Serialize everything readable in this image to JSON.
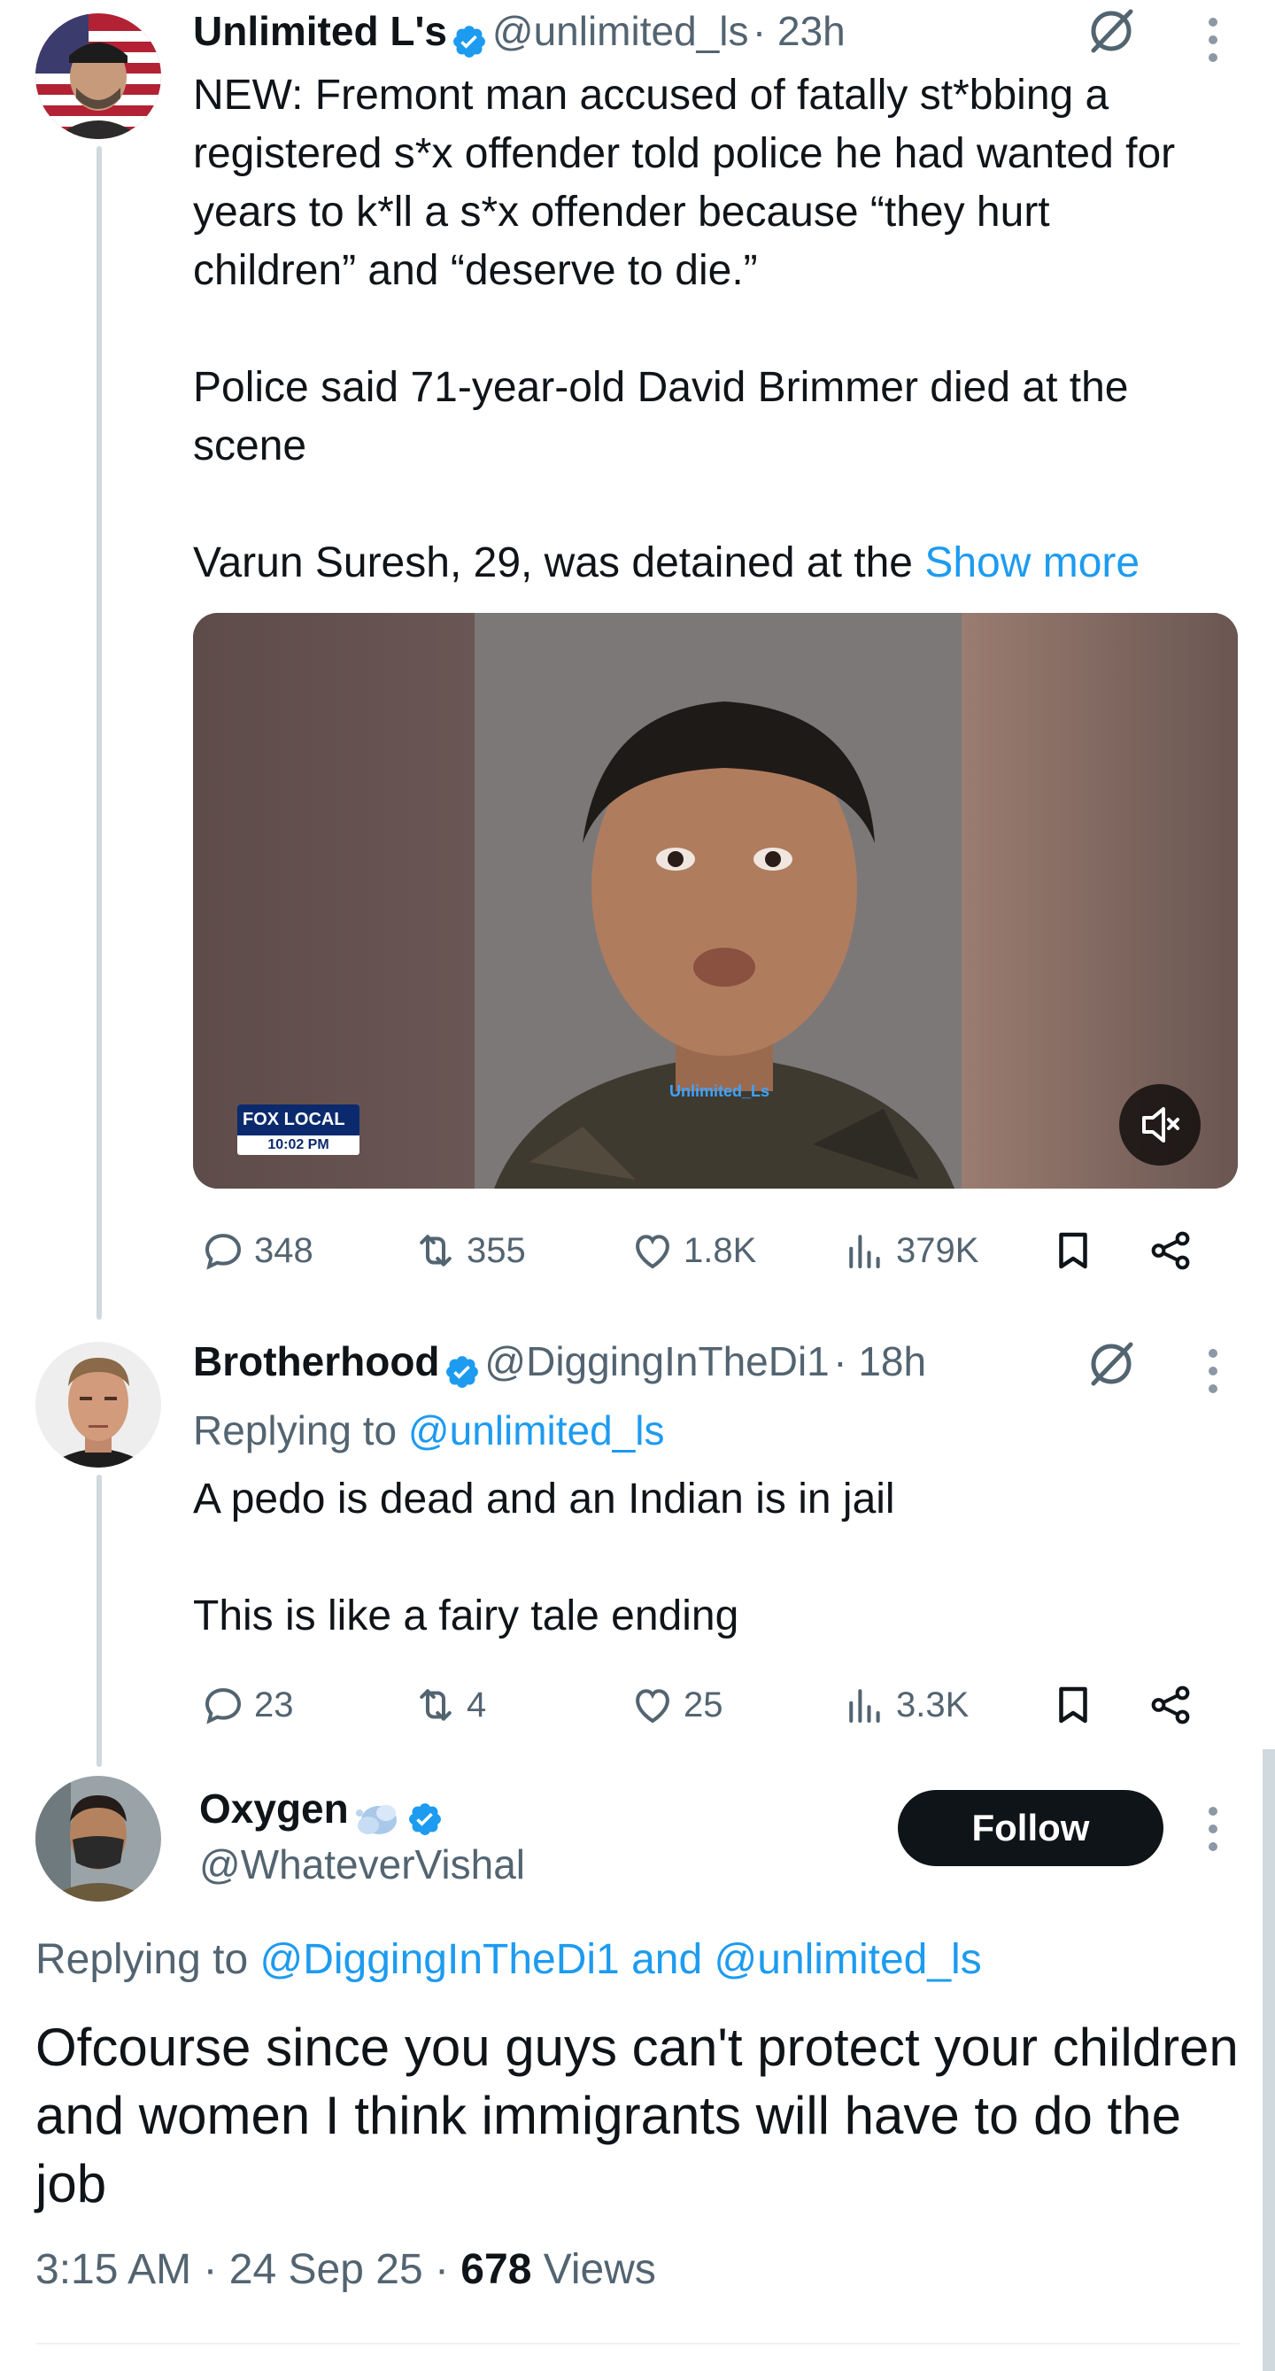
{
  "tweet1": {
    "name": "Unlimited L's",
    "handle": "@unlimited_ls",
    "time": "· 23h",
    "text_p1": "NEW: Fremont man accused of fatally st*bbing a registered s*x offender told police he had wanted for years to k*ll a s*x offender because “they hurt children” and “deserve to die.”",
    "text_p2": "Police said 71-year-old David Brimmer died at the scene",
    "text_p3": "Varun Suresh, 29, was detained at the ",
    "show_more": "Show more",
    "media": {
      "network_logo": "FOX LOCAL",
      "timestamp": "10:02 PM",
      "watermark": "Unlimited_Ls"
    },
    "stats": {
      "replies": "348",
      "reposts": "355",
      "likes": "1.8K",
      "views": "379K"
    }
  },
  "tweet2": {
    "name": "Brotherhood",
    "handle": "@DiggingInTheDi1",
    "time": "· 18h",
    "replying_prefix": "Replying to ",
    "replying_to": "@unlimited_ls",
    "text_p1": "A pedo is dead and an Indian is in jail",
    "text_p2": "This is like a fairy tale ending",
    "stats": {
      "replies": "23",
      "reposts": "4",
      "likes": "25",
      "views": "3.3K"
    }
  },
  "tweet3": {
    "name": "Oxygen",
    "handle": "@WhateverVishal",
    "follow_label": "Follow",
    "replying_prefix": "Replying to ",
    "replying_user1": "@DiggingInTheDi1",
    "replying_and": " and ",
    "replying_user2": "@unlimited_ls",
    "text": "Ofcourse since you guys can't protect your children and women I think immigrants will have to do the job",
    "time": "3:15 AM",
    "date": "· 24 Sep 25 ·",
    "views_count": "678",
    "views_label": "Views"
  },
  "colors": {
    "accent": "#1d9bf0",
    "text": "#0f1419",
    "secondary": "#536471"
  }
}
